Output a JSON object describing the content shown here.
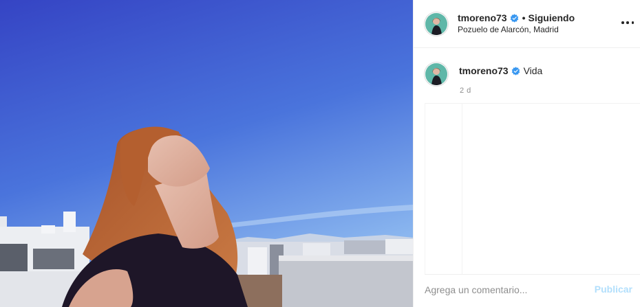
{
  "post": {
    "photo_alt": "",
    "author": {
      "username": "tmoreno73",
      "verified": true,
      "follow_status": "Siguiendo",
      "separator": "•",
      "location": "Pozuelo de Alarcón, Madrid"
    },
    "caption": {
      "username": "tmoreno73",
      "text": "Vida",
      "time_ago": "2 d"
    },
    "comment": {
      "placeholder": "Agrega un comentario...",
      "value": "",
      "submit_label": "Publicar"
    },
    "icons": {
      "options": "more-options-icon",
      "verified": "verified-badge-icon"
    },
    "colors": {
      "verified": "#3897f0",
      "publish_disabled": "#b2dffc",
      "muted_text": "#8e8e8e",
      "sky": "#3a5bd6"
    }
  }
}
